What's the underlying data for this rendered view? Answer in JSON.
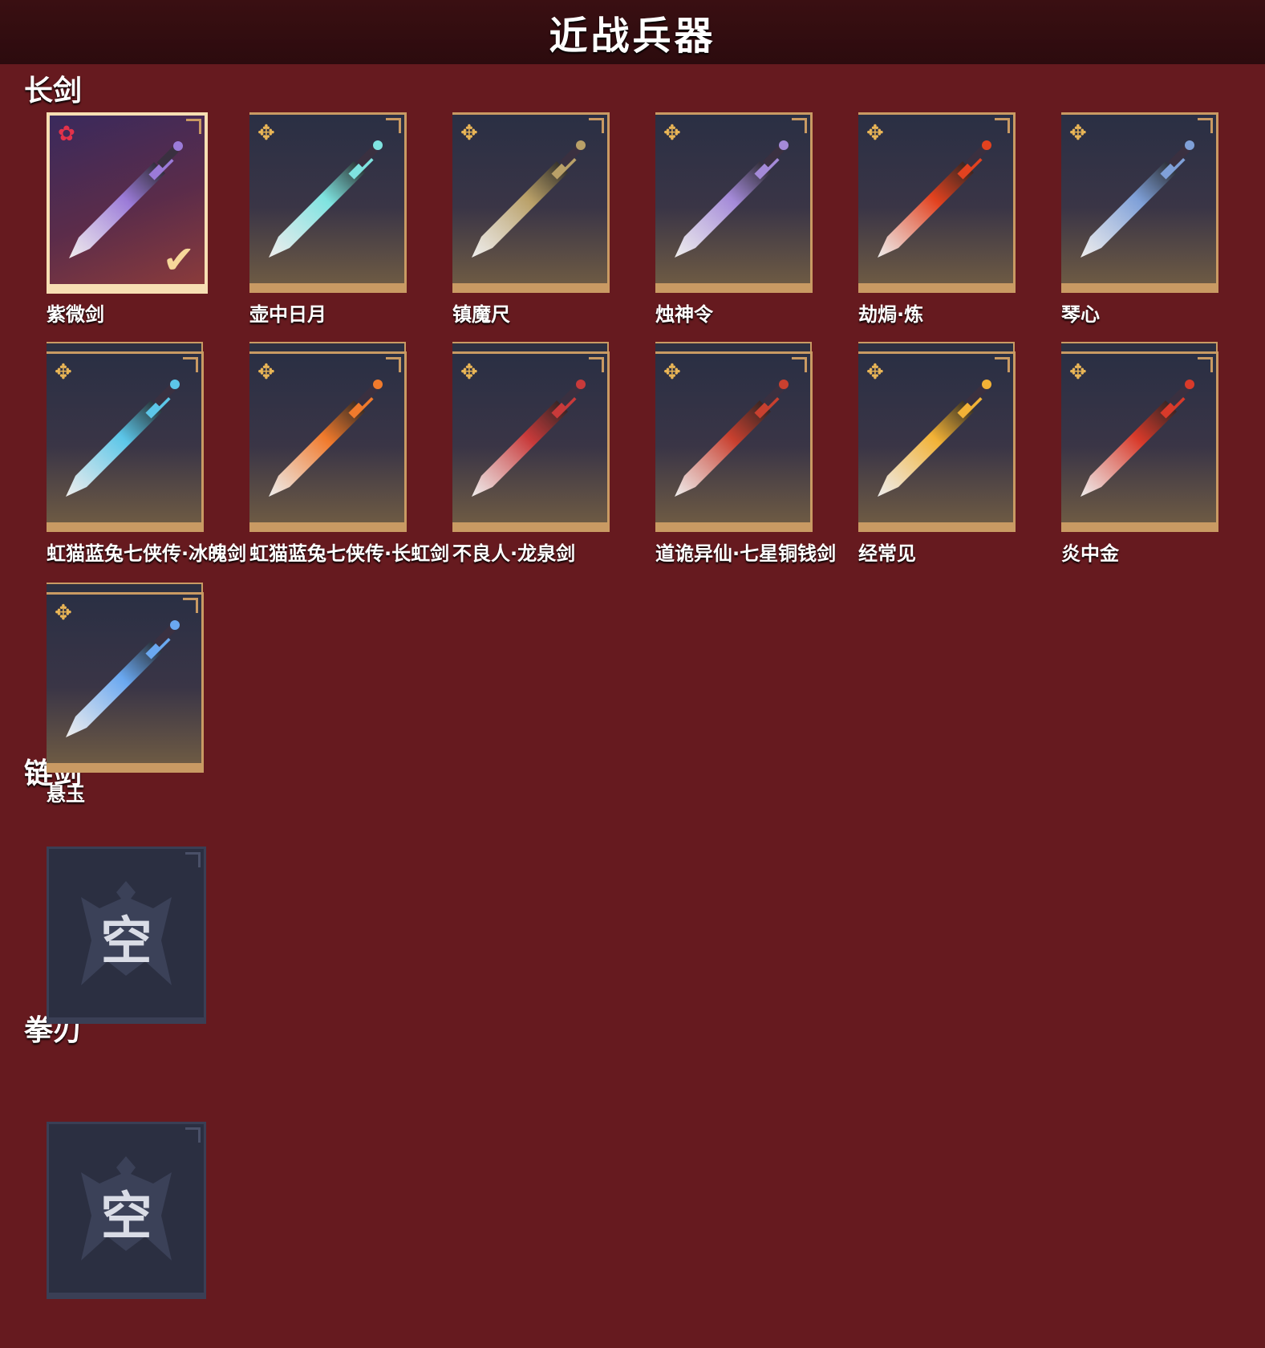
{
  "title": "近战兵器",
  "colors": {
    "background": "#661a1f",
    "topbar": "#2c0b0e",
    "card_border": "#c99a63",
    "selected_border": "#f7dfb3",
    "badge_gold": "#e9b556",
    "badge_red": "#e4324a"
  },
  "sections": [
    {
      "title": "长剑",
      "items": [
        {
          "name": "紫微剑",
          "selected": true,
          "blade_color": "#9b7bd8",
          "icon": "sword-icon"
        },
        {
          "name": "壶中日月",
          "blade_color": "#7fe3e0",
          "icon": "sword-icon"
        },
        {
          "name": "镇魔尺",
          "blade_color": "#b9a068",
          "icon": "sword-icon"
        },
        {
          "name": "烛神令",
          "blade_color": "#a48ad8",
          "icon": "sword-icon"
        },
        {
          "name": "劫焗·炼",
          "blade_color": "#e2421f",
          "icon": "sword-icon"
        },
        {
          "name": "琴心",
          "blade_color": "#7fa0d8",
          "icon": "sword-icon"
        },
        {
          "name": "虹猫蓝兔七侠传·冰魄剑",
          "display": "虹猫蓝兔七侠传·冰魄剑",
          "blade_color": "#5cc6e8",
          "icon": "sword-icon"
        },
        {
          "name": "虹猫蓝兔七侠传·长虹剑",
          "blade_color": "#f07a2c",
          "icon": "sword-icon"
        },
        {
          "name": "不良人·龙泉剑",
          "blade_color": "#c83a3a",
          "icon": "sword-icon"
        },
        {
          "name": "道诡异仙·七星铜钱剑",
          "blade_color": "#c8402f",
          "icon": "sword-icon"
        },
        {
          "name": "经常见",
          "blade_color": "#f2b236",
          "icon": "sword-icon"
        },
        {
          "name": "炎中金",
          "blade_color": "#d83a2a",
          "icon": "sword-icon"
        },
        {
          "name": "悬玉",
          "blade_color": "#6aa8f0",
          "icon": "sword-icon"
        }
      ]
    },
    {
      "title": "链剑",
      "items": [
        {
          "name": "空",
          "empty": true
        }
      ]
    },
    {
      "title": "拳刃",
      "items": [
        {
          "name": "空",
          "empty": true
        }
      ]
    }
  ],
  "labels": {
    "row2": [
      "虹猫蓝兔七侠传·冰魄",
      "虹猫蓝兔七侠传·长虹",
      "不良人·龙泉剑"
    ]
  }
}
